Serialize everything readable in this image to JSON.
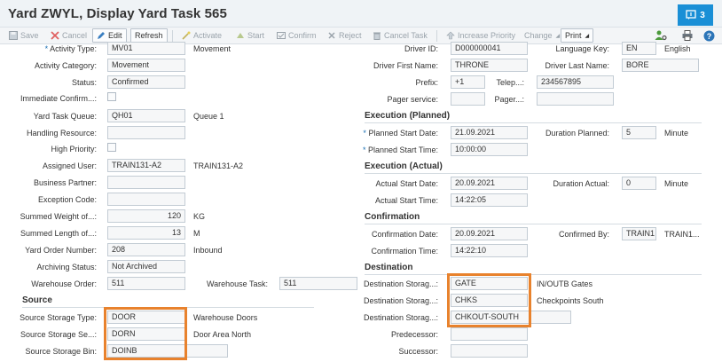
{
  "window": {
    "title": "Yard ZWYL, Display Yard Task 565",
    "notification_count": "3",
    "accent_color": "#1a8fd6",
    "highlight_color": "#e8822d"
  },
  "toolbar": {
    "save": "Save",
    "cancel": "Cancel",
    "edit": "Edit",
    "refresh": "Refresh",
    "activate": "Activate",
    "start": "Start",
    "confirm": "Confirm",
    "reject": "Reject",
    "cancel_task": "Cancel Task",
    "increase_priority": "Increase Priority",
    "change": "Change",
    "print": "Print"
  },
  "left": {
    "activity_type": {
      "label": "Activity Type:",
      "value": "MV01",
      "desc": "Movement"
    },
    "activity_category": {
      "label": "Activity Category:",
      "value": "Movement"
    },
    "status": {
      "label": "Status:",
      "value": "Confirmed"
    },
    "immediate_confirm": {
      "label": "Immediate Confirm...:"
    },
    "yard_task_queue": {
      "label": "Yard Task Queue:",
      "value": "QH01",
      "desc": "Queue 1"
    },
    "handling_resource": {
      "label": "Handling Resource:",
      "value": ""
    },
    "high_priority": {
      "label": "High Priority:"
    },
    "assigned_user": {
      "label": "Assigned User:",
      "value": "TRAIN131-A2",
      "desc": "TRAIN131-A2"
    },
    "business_partner": {
      "label": "Business Partner:",
      "value": ""
    },
    "exception_code": {
      "label": "Exception Code:",
      "value": ""
    },
    "summed_weight": {
      "label": "Summed Weight of...:",
      "value": "120",
      "unit": "KG"
    },
    "summed_length": {
      "label": "Summed Length of...:",
      "value": "13",
      "unit": "M"
    },
    "yard_order_number": {
      "label": "Yard Order Number:",
      "value": "208",
      "desc": "Inbound"
    },
    "archiving_status": {
      "label": "Archiving Status:",
      "value": "Not Archived"
    },
    "warehouse_order": {
      "label": "Warehouse Order:",
      "value": "511"
    },
    "warehouse_task": {
      "label": "Warehouse Task:",
      "value": "511"
    }
  },
  "source": {
    "title": "Source",
    "storage_type": {
      "label": "Source Storage Type:",
      "value": "DOOR",
      "desc": "Warehouse Doors"
    },
    "storage_section": {
      "label": "Source Storage Se...:",
      "value": "DORN",
      "desc": "Door Area North"
    },
    "storage_bin": {
      "label": "Source Storage Bin:",
      "value": "DOINB"
    }
  },
  "driver": {
    "driver_id": {
      "label": "Driver ID:",
      "value": "D000000041"
    },
    "language_key": {
      "label": "Language Key:",
      "value": "EN",
      "desc": "English"
    },
    "first_name": {
      "label": "Driver First Name:",
      "value": "THRONE"
    },
    "last_name": {
      "label": "Driver Last Name:",
      "value": "BORE"
    },
    "prefix": {
      "label": "Prefix:",
      "value": "+1"
    },
    "telephone": {
      "label": "Telep...:",
      "value": "234567895"
    },
    "pager_service": {
      "label": "Pager service:",
      "value": ""
    },
    "pager": {
      "label": "Pager...:",
      "value": ""
    }
  },
  "execution_planned": {
    "title": "Execution (Planned)",
    "start_date": {
      "label": "Planned Start Date:",
      "value": "21.09.2021"
    },
    "duration": {
      "label": "Duration Planned:",
      "value": "5",
      "unit": "Minute"
    },
    "start_time": {
      "label": "Planned Start Time:",
      "value": "10:00:00"
    }
  },
  "execution_actual": {
    "title": "Execution (Actual)",
    "start_date": {
      "label": "Actual Start Date:",
      "value": "20.09.2021"
    },
    "duration": {
      "label": "Duration Actual:",
      "value": "0",
      "unit": "Minute"
    },
    "start_time": {
      "label": "Actual Start Time:",
      "value": "14:22:05"
    }
  },
  "confirmation": {
    "title": "Confirmation",
    "date": {
      "label": "Confirmation Date:",
      "value": "20.09.2021"
    },
    "confirmed_by": {
      "label": "Confirmed By:",
      "value": "TRAIN1",
      "desc": "TRAIN1..."
    },
    "time": {
      "label": "Confirmation Time:",
      "value": "14:22:10"
    }
  },
  "destination": {
    "title": "Destination",
    "storage_type": {
      "label": "Destination Storag...:",
      "value": "GATE",
      "desc": "IN/OUTB Gates"
    },
    "storage_section": {
      "label": "Destination Storag...:",
      "value": "CHKS",
      "desc": "Checkpoints South"
    },
    "storage_bin": {
      "label": "Destination Storag...:",
      "value": "CHKOUT-SOUTH"
    },
    "predecessor": {
      "label": "Predecessor:",
      "value": ""
    },
    "successor": {
      "label": "Successor:",
      "value": ""
    }
  }
}
